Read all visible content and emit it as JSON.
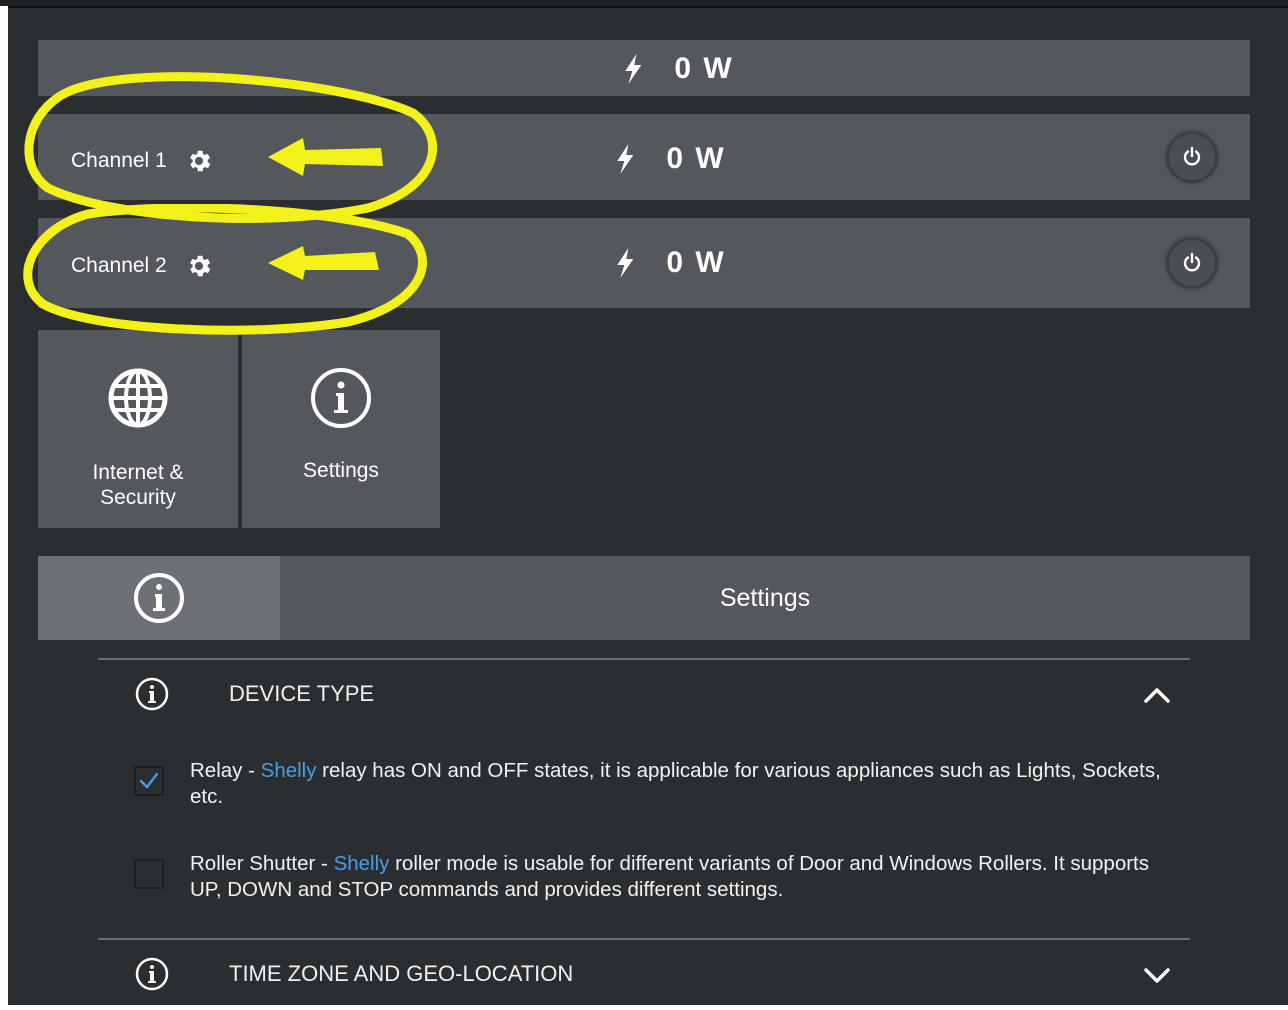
{
  "summary": {
    "power_value": "0 W"
  },
  "channels": [
    {
      "label": "Channel 1",
      "power_value": "0 W",
      "toggle_icon": "power-icon"
    },
    {
      "label": "Channel 2",
      "power_value": "0 W",
      "toggle_icon": "power-icon"
    }
  ],
  "tiles": [
    {
      "label_line1": "Internet &",
      "label_line2": "Security",
      "icon": "globe-icon"
    },
    {
      "label": "Settings",
      "icon": "info-icon"
    }
  ],
  "tabs": {
    "info_icon": "info-icon",
    "settings_label": "Settings"
  },
  "sections": {
    "device_type": {
      "title": "DEVICE TYPE",
      "expanded": true,
      "options": [
        {
          "checked": true,
          "name": "Relay",
          "sep": " - ",
          "brand": "Shelly",
          "desc": " relay has ON and OFF states, it is applicable for various appliances such as Lights, Sockets, etc."
        },
        {
          "checked": false,
          "name": "Roller Shutter",
          "sep": " - ",
          "brand": "Shelly",
          "desc": " roller mode is usable for different variants of Door and Windows Rollers. It supports UP, DOWN and STOP commands and provides different settings."
        }
      ]
    },
    "time_zone": {
      "title": "TIME ZONE AND GEO-LOCATION",
      "expanded": false
    }
  },
  "colors": {
    "background": "#2b2e30",
    "panel": "#54585c",
    "active_tab": "#6d7175",
    "brand_link": "#4a9ce8",
    "annotation": "#f4f01a"
  }
}
